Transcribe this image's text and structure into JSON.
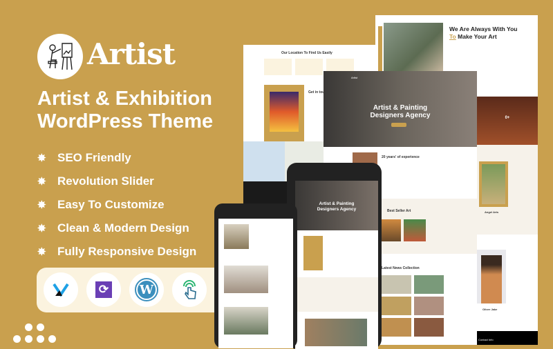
{
  "brand": {
    "name": "Artist",
    "logo_icon": "painter-at-easel-icon"
  },
  "headline": {
    "line1": "Artist & Exhibition",
    "line2": "WordPress Theme"
  },
  "features": [
    {
      "label": "SEO Friendly",
      "icon": "star-burst-icon"
    },
    {
      "label": "Revolution Slider",
      "icon": "star-burst-icon"
    },
    {
      "label": "Easy To Customize",
      "icon": "star-burst-icon"
    },
    {
      "label": "Clean & Modern Design",
      "icon": "star-burst-icon"
    },
    {
      "label": "Fully Responsive Design",
      "icon": "star-burst-icon"
    }
  ],
  "compat_icons": [
    "elementor-x-icon",
    "revolution-slider-icon",
    "wordpress-icon",
    "touch-responsive-icon"
  ],
  "mockups": {
    "location_title": "Our Location To Find Us Easily",
    "get_in_touch": "Get in touch",
    "about_title_1": "We Are Always With You",
    "about_title_to": "To",
    "about_title_2": "Make Your Art",
    "hero_title_1": "Artist & Painting",
    "hero_title_2": "Designers Agency",
    "experience": "20 years' of experience",
    "best_seller": "Best Seller Art",
    "news": "Latest News Collection",
    "angel_arts": "Angel Arts",
    "counter": "0+",
    "person": "Oliver Jake",
    "contact": "Contact Info",
    "site_logo": "Artist"
  },
  "colors": {
    "background": "#c9a04e",
    "accent": "#c9a04e",
    "cream": "#fbf3df"
  }
}
